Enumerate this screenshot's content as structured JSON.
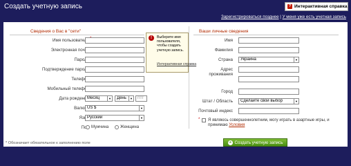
{
  "header": {
    "title": "Создать учетную запись",
    "help_label": "Интерактивная справка",
    "help_icon": "question-icon",
    "links": {
      "register_later": "Зарегистрироваться позднее",
      "separator": " | ",
      "have_account": "У меня уже есть учетная запись"
    }
  },
  "left": {
    "title": "Сведения о Вас в \"сети\"",
    "username": "Имя пользователя",
    "email": "Электронная почта",
    "password": "Пароль",
    "confirm_password": "Подтверждение пароля",
    "phone": "Телефон",
    "mobile": "Мобильный телефон",
    "birthdate": "Дата рождения",
    "birth_month": "Месяц",
    "birth_day": "День",
    "birth_year": "гггг",
    "currency": "Валюта",
    "currency_value": "US $",
    "language": "Язык",
    "language_value": "Русский",
    "gender": "Пол",
    "male": "Мужчина",
    "female": "Женщина"
  },
  "tooltip": {
    "text": "Выберите имя пользователя, чтобы создать учетную запись.",
    "link": "Интерактивная справка"
  },
  "right": {
    "title": "Ваши личные сведения",
    "first_name": "Имя",
    "last_name": "Фамилия",
    "country": "Страна",
    "country_value": "Украина",
    "address": "Адрес проживания",
    "city": "Город",
    "state": "Штат / Область",
    "state_value": "Сделайте свой выбор",
    "zip": "Почтовый индекс",
    "agree_text": "Я являюсь совершеннолетним, могу играть в азартные игры, и принимаю",
    "terms_link": "Условия"
  },
  "footer": {
    "note": "* Обозначает обязательное к заполнению поле",
    "submit": "Создать учетную запись"
  },
  "colors": {
    "background": "#1d1d5c",
    "section_title": "#b12a00",
    "submit": "#5fa31f",
    "required": "#cc0000"
  }
}
